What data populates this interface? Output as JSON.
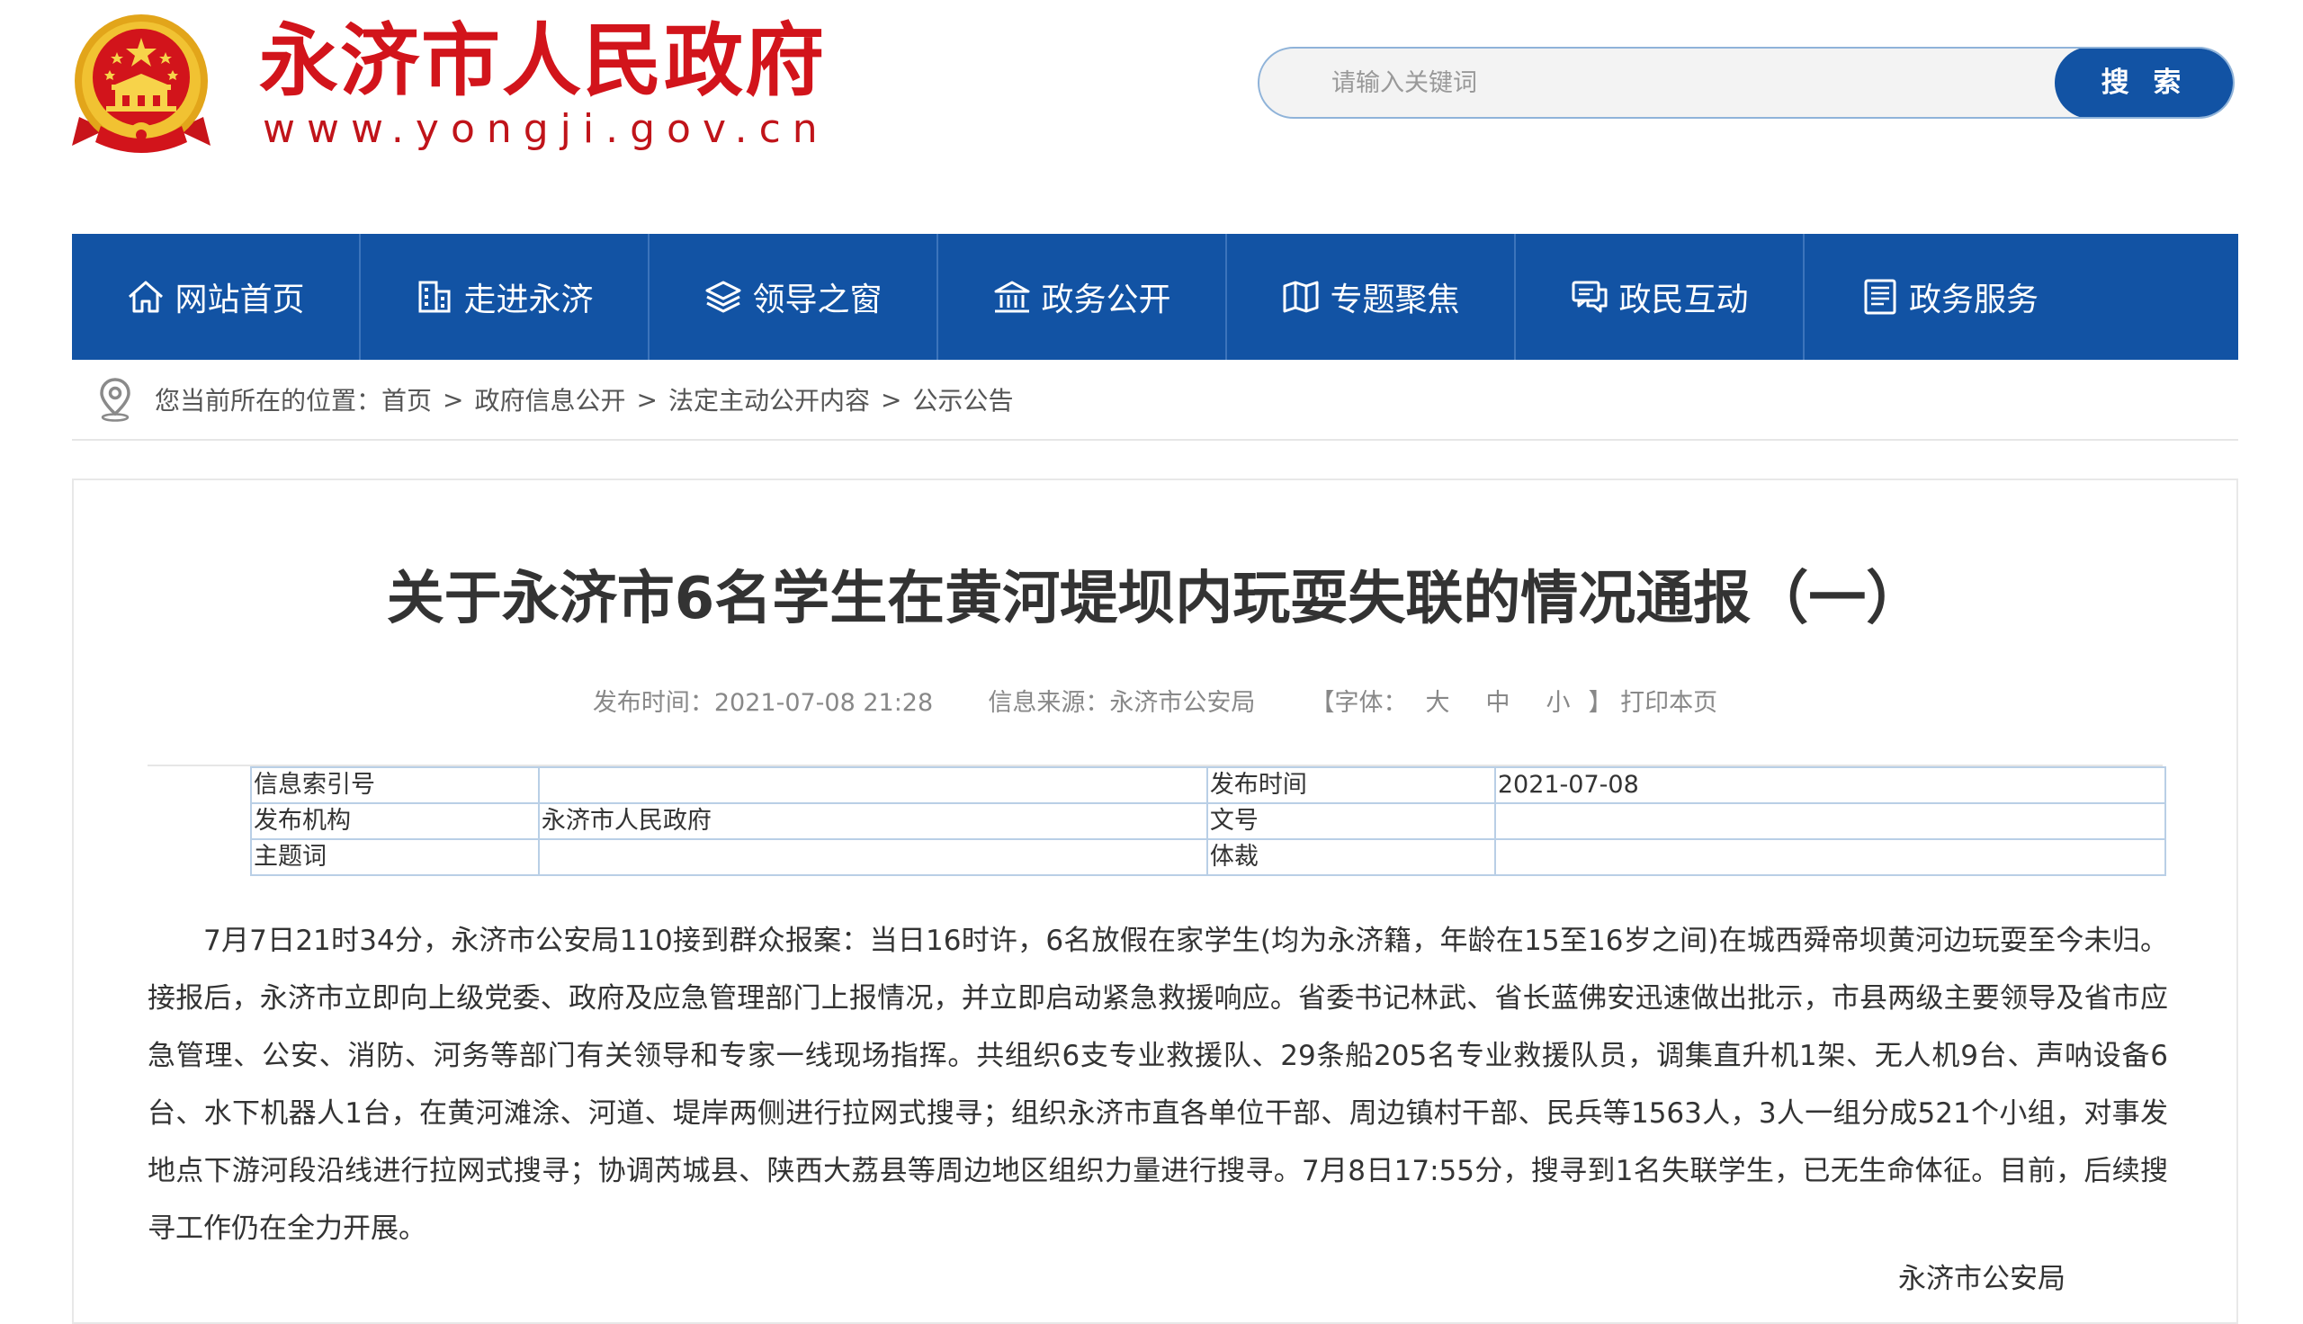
{
  "header": {
    "site_title": "永济市人民政府",
    "site_url": "www.yongji.gov.cn",
    "emblem_icon": "national-emblem-icon",
    "brand_color": "#d2141b"
  },
  "search": {
    "placeholder": "请输入关键词",
    "button_label": "搜 索",
    "button_color": "#1253a4"
  },
  "nav": {
    "background": "#1253a4",
    "items": [
      {
        "label": "网站首页",
        "icon": "home-icon"
      },
      {
        "label": "走进永济",
        "icon": "building-icon"
      },
      {
        "label": "领导之窗",
        "icon": "layers-icon"
      },
      {
        "label": "政务公开",
        "icon": "government-building-icon"
      },
      {
        "label": "专题聚焦",
        "icon": "map-book-icon"
      },
      {
        "label": "政民互动",
        "icon": "chat-icon"
      },
      {
        "label": "政务服务",
        "icon": "document-list-icon"
      }
    ]
  },
  "breadcrumb": {
    "prefix": "您当前所在的位置：",
    "separator": ">",
    "items": [
      "首页",
      "政府信息公开",
      "法定主动公开内容",
      "公示公告"
    ]
  },
  "article": {
    "title": "关于永济市6名学生在黄河堤坝内玩耍失联的情况通报（一）",
    "meta": {
      "publish_label": "发布时间：",
      "publish_time": "2021-07-08 21:28",
      "source_label": "信息来源：",
      "source": "永济市公安局",
      "font_size_open": "【字体：",
      "font_large": "大",
      "font_medium": "中",
      "font_small": "小",
      "font_size_close": "】",
      "print_label": "打印本页"
    },
    "info_table": {
      "index_label": "信息索引号",
      "index_value": "",
      "date_label": "发布时间",
      "date_value": "2021-07-08",
      "org_label": "发布机构",
      "org_value": "永济市人民政府",
      "doc_no_label": "文号",
      "doc_no_value": "",
      "keywords_label": "主题词",
      "keywords_value": "",
      "genre_label": "体裁",
      "genre_value": ""
    },
    "body": "7月7日21时34分，永济市公安局110接到群众报案：当日16时许，6名放假在家学生(均为永济籍，年龄在15至16岁之间)在城西舜帝坝黄河边玩耍至今未归。接报后，永济市立即向上级党委、政府及应急管理部门上报情况，并立即启动紧急救援响应。省委书记林武、省长蓝佛安迅速做出批示，市县两级主要领导及省市应急管理、公安、消防、河务等部门有关领导和专家一线现场指挥。共组织6支专业救援队、29条船205名专业救援队员，调集直升机1架、无人机9台、声呐设备6台、水下机器人1台，在黄河滩涂、河道、堤岸两侧进行拉网式搜寻；组织永济市直各单位干部、周边镇村干部、民兵等1563人，3人一组分成521个小组，对事发地点下游河段沿线进行拉网式搜寻；协调芮城县、陕西大荔县等周边地区组织力量进行搜寻。7月8日17:55分，搜寻到1名失联学生，已无生命体征。目前，后续搜寻工作仍在全力开展。",
    "signature": "永济市公安局"
  }
}
